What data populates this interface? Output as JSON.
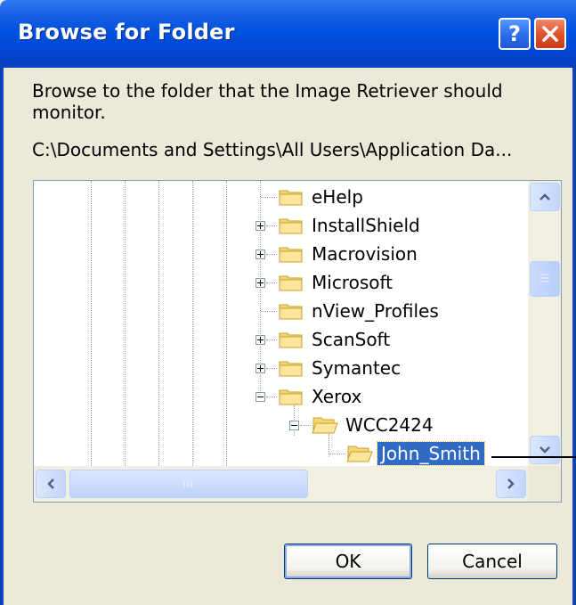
{
  "window": {
    "title": "Browse for Folder",
    "help_label": "?",
    "description": "Browse to the folder that the Image Retriever should monitor.",
    "path": "C:\\Documents and Settings\\All Users\\Application Da..."
  },
  "tree": {
    "items": [
      {
        "label": "eHelp",
        "expander": "none"
      },
      {
        "label": "InstallShield",
        "expander": "plus"
      },
      {
        "label": "Macrovision",
        "expander": "plus"
      },
      {
        "label": "Microsoft",
        "expander": "plus"
      },
      {
        "label": "nView_Profiles",
        "expander": "none"
      },
      {
        "label": "ScanSoft",
        "expander": "plus"
      },
      {
        "label": "Symantec",
        "expander": "plus"
      },
      {
        "label": "Xerox",
        "expander": "minus"
      },
      {
        "label": "WCC2424",
        "expander": "minus"
      },
      {
        "label": "John_Smith",
        "expander": "none",
        "selected": true
      }
    ]
  },
  "buttons": {
    "ok": "OK",
    "cancel": "Cancel"
  },
  "colors": {
    "title_bar": "#0052e0",
    "selection": "#316ac5",
    "dialog_bg": "#ece9d8",
    "close_button": "#e0532c"
  },
  "icons": {
    "folder": "folder-icon",
    "open_folder": "open-folder-icon",
    "help": "help-icon",
    "close": "close-icon"
  }
}
